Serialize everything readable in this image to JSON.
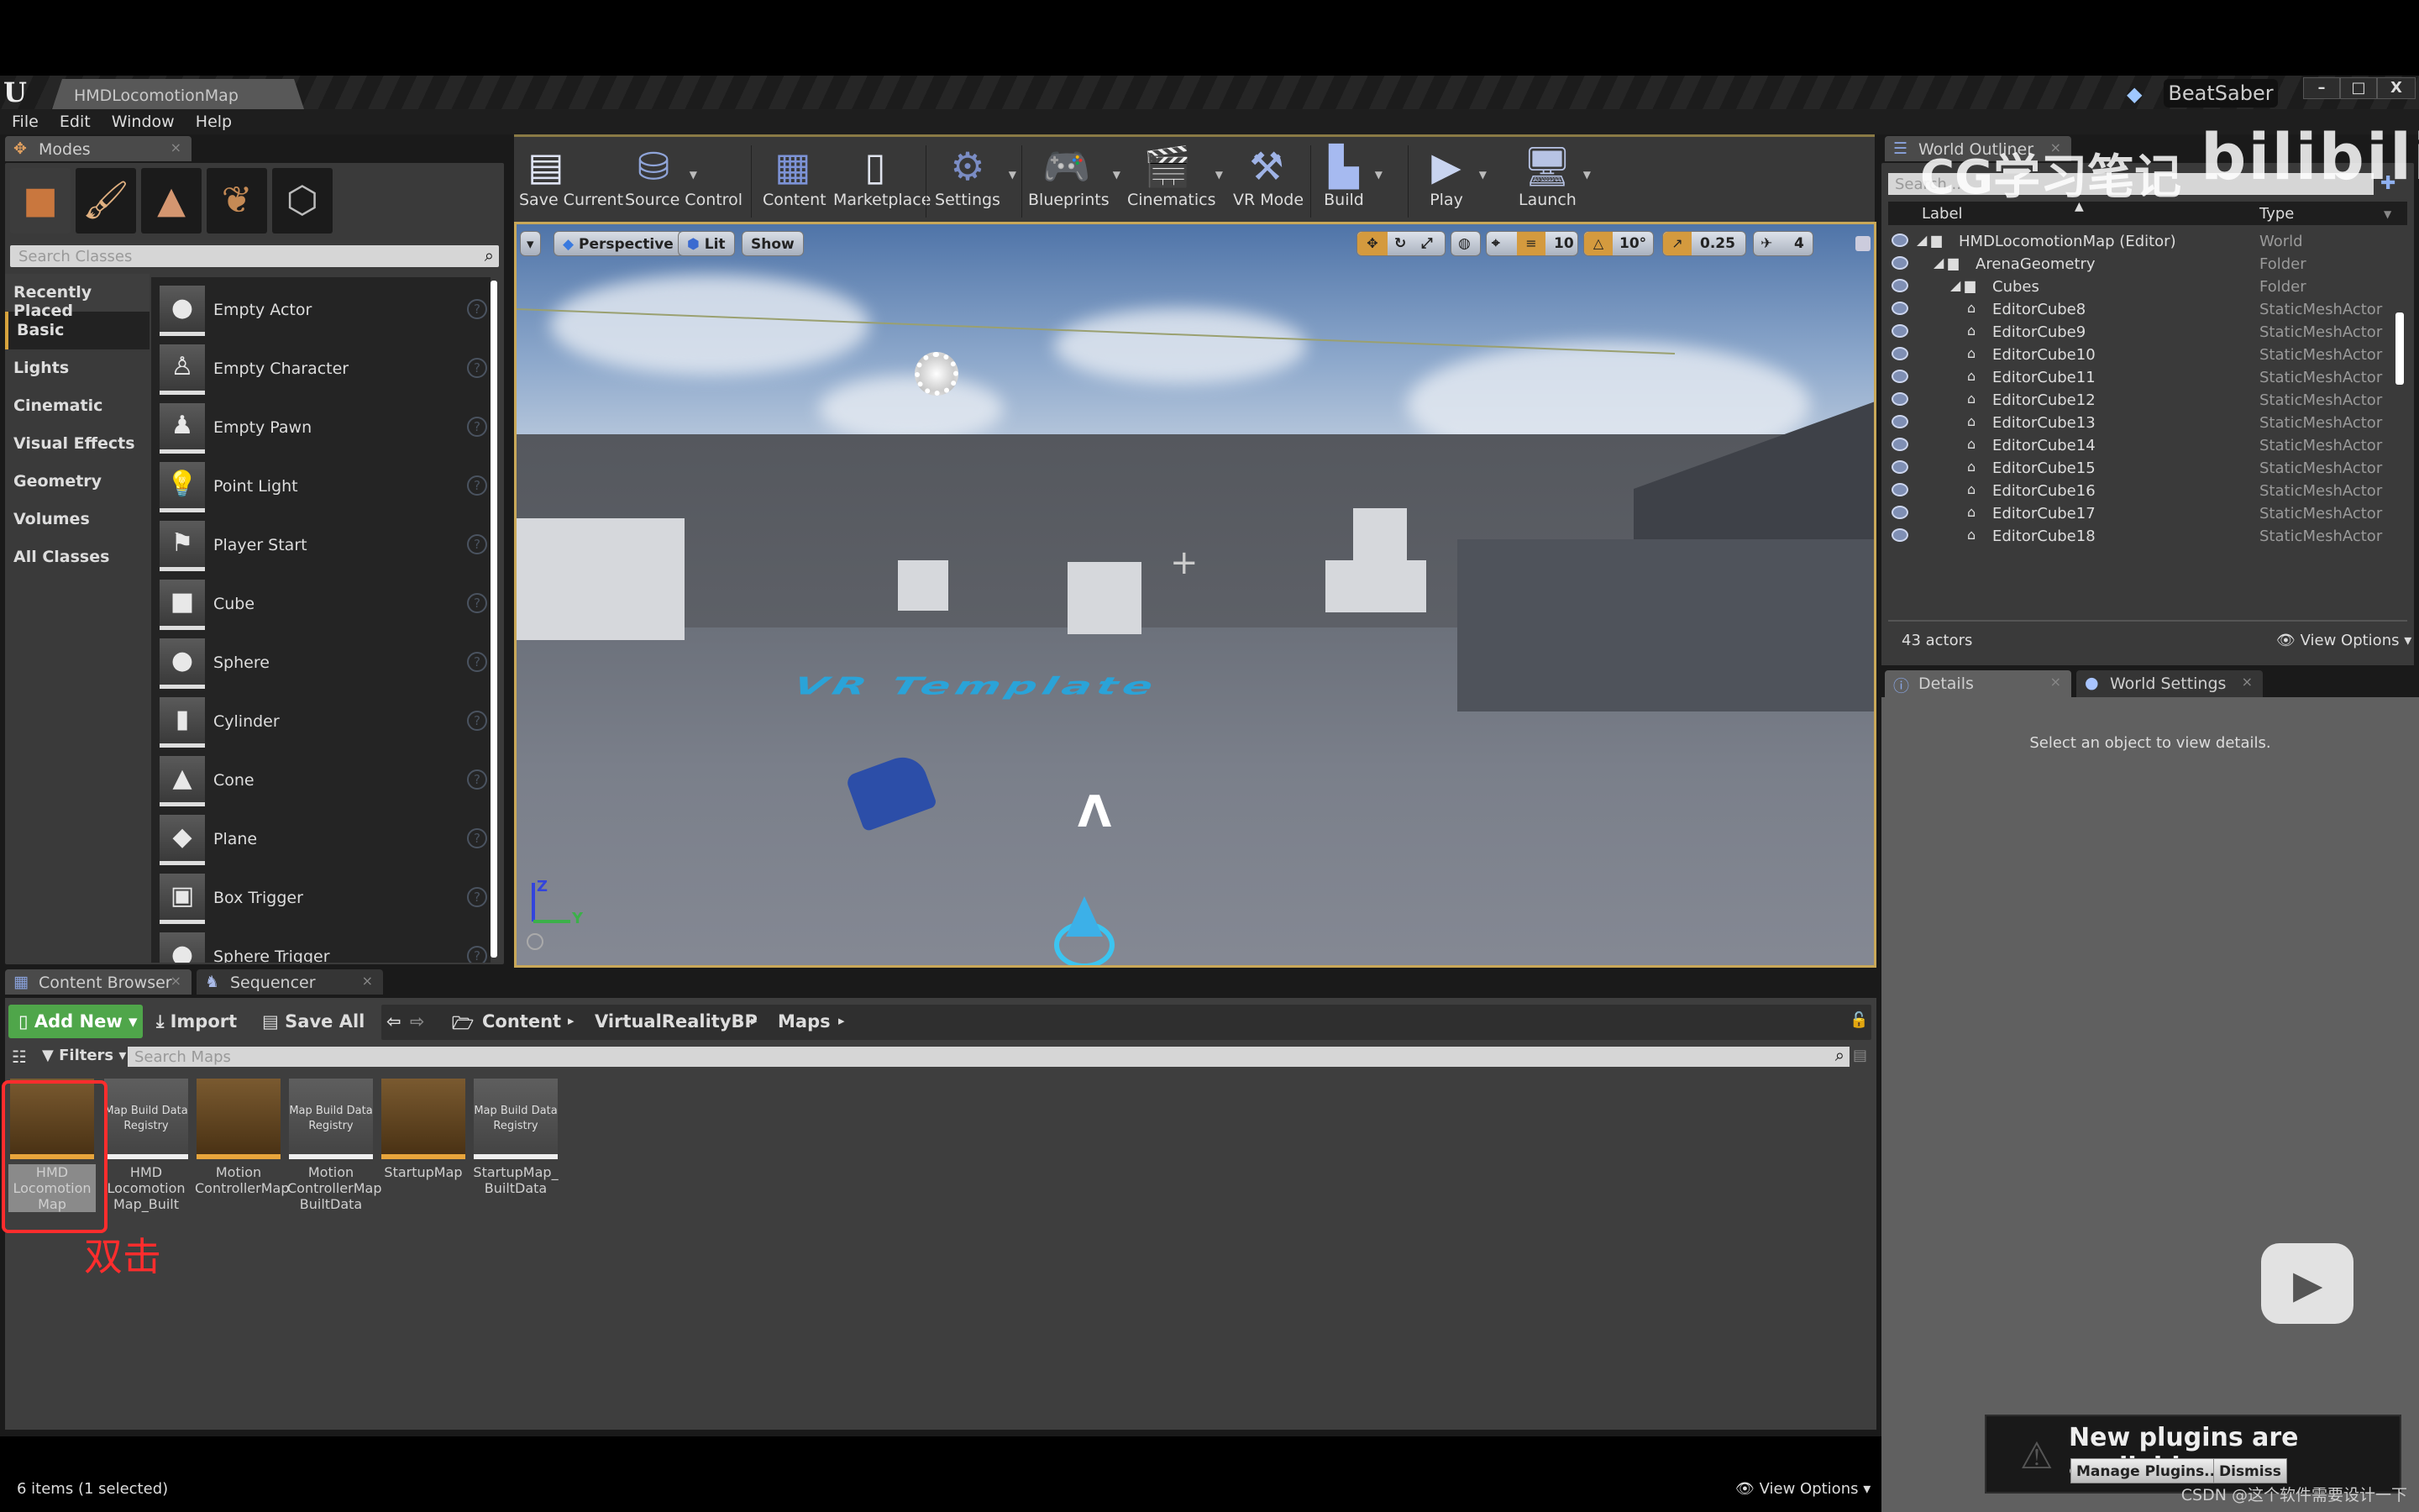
{
  "window": {
    "map_tab": "HMDLocomotionMap",
    "project_name": "BeatSaber",
    "minimize": "–",
    "restore": "□",
    "close": "X"
  },
  "menu": [
    "File",
    "Edit",
    "Window",
    "Help"
  ],
  "modes_panel": {
    "tab_label": "Modes",
    "search_placeholder": "Search Classes",
    "categories": [
      "Recently Placed",
      "Basic",
      "Lights",
      "Cinematic",
      "Visual Effects",
      "Geometry",
      "Volumes",
      "All Classes"
    ],
    "selected_category": "Basic",
    "classes": [
      "Empty Actor",
      "Empty Character",
      "Empty Pawn",
      "Point Light",
      "Player Start",
      "Cube",
      "Sphere",
      "Cylinder",
      "Cone",
      "Plane",
      "Box Trigger",
      "Sphere Trigger"
    ]
  },
  "toolbar": {
    "items": [
      {
        "label": "Save Current",
        "icon": "save-icon"
      },
      {
        "label": "Source Control",
        "icon": "source-control-icon"
      },
      {
        "label": "Content",
        "icon": "content-icon"
      },
      {
        "label": "Marketplace",
        "icon": "marketplace-icon"
      },
      {
        "label": "Settings",
        "icon": "settings-icon"
      },
      {
        "label": "Blueprints",
        "icon": "blueprints-icon"
      },
      {
        "label": "Cinematics",
        "icon": "cinematics-icon"
      },
      {
        "label": "VR Mode",
        "icon": "vr-mode-icon"
      },
      {
        "label": "Build",
        "icon": "build-icon"
      },
      {
        "label": "Play",
        "icon": "play-icon"
      },
      {
        "label": "Launch",
        "icon": "launch-icon"
      }
    ]
  },
  "viewport": {
    "view_mode": "Perspective",
    "lighting": "Lit",
    "show": "Show",
    "grid_snap": "10",
    "rotation_snap": "10°",
    "scale_snap": "0.25",
    "camera_speed": "4",
    "floor_text": "VR Template",
    "axis_z": "Z",
    "axis_y": "Y"
  },
  "world_outliner": {
    "tab_label": "World Outliner",
    "search_placeholder": "Search...",
    "col_label": "Label",
    "col_type": "Type",
    "rows": [
      {
        "name": "HMDLocomotionMap (Editor)",
        "type": "World",
        "depth": 0
      },
      {
        "name": "ArenaGeometry",
        "type": "Folder",
        "depth": 1
      },
      {
        "name": "Cubes",
        "type": "Folder",
        "depth": 2
      },
      {
        "name": "EditorCube8",
        "type": "StaticMeshActor",
        "depth": 3
      },
      {
        "name": "EditorCube9",
        "type": "StaticMeshActor",
        "depth": 3
      },
      {
        "name": "EditorCube10",
        "type": "StaticMeshActor",
        "depth": 3
      },
      {
        "name": "EditorCube11",
        "type": "StaticMeshActor",
        "depth": 3
      },
      {
        "name": "EditorCube12",
        "type": "StaticMeshActor",
        "depth": 3
      },
      {
        "name": "EditorCube13",
        "type": "StaticMeshActor",
        "depth": 3
      },
      {
        "name": "EditorCube14",
        "type": "StaticMeshActor",
        "depth": 3
      },
      {
        "name": "EditorCube15",
        "type": "StaticMeshActor",
        "depth": 3
      },
      {
        "name": "EditorCube16",
        "type": "StaticMeshActor",
        "depth": 3
      },
      {
        "name": "EditorCube17",
        "type": "StaticMeshActor",
        "depth": 3
      },
      {
        "name": "EditorCube18",
        "type": "StaticMeshActor",
        "depth": 3
      }
    ],
    "actor_count": "43 actors",
    "view_options": "View Options"
  },
  "details": {
    "tab_details": "Details",
    "tab_world_settings": "World Settings",
    "empty_message": "Select an object to view details."
  },
  "content_browser": {
    "tab_label": "Content Browser",
    "tab_sequencer": "Sequencer",
    "add_new": "Add New",
    "import": "Import",
    "save_all": "Save All",
    "breadcrumbs": [
      "Content",
      "VirtualRealityBP",
      "Maps"
    ],
    "filters": "Filters",
    "search_placeholder": "Search Maps",
    "assets": [
      {
        "name": "HMD Locomotion Map",
        "kind": "map",
        "selected": true
      },
      {
        "name": "HMD Locomotion Map_Built",
        "kind": "registry",
        "thumb_text": "Map Build Data Registry"
      },
      {
        "name": "Motion ControllerMap",
        "kind": "map"
      },
      {
        "name": "Motion ControllerMap BuiltData",
        "kind": "registry",
        "thumb_text": "Map Build Data Registry"
      },
      {
        "name": "StartupMap",
        "kind": "map"
      },
      {
        "name": "StartupMap_ BuiltData",
        "kind": "registry",
        "thumb_text": "Map Build Data Registry"
      }
    ],
    "item_count": "6 items (1 selected)",
    "view_options": "View Options",
    "annotation": "双击"
  },
  "notification": {
    "title": "New plugins are available",
    "manage": "Manage Plugins...",
    "dismiss": "Dismiss"
  },
  "watermarks": {
    "top": "CG学习笔记",
    "bilibili": "bilibili",
    "bottom": "CSDN @这个软件需要设计一下"
  },
  "colors": {
    "accent_gold": "#d7a33d",
    "add_new_green": "#4fa64a",
    "annotation_red": "#ff2d2d"
  }
}
